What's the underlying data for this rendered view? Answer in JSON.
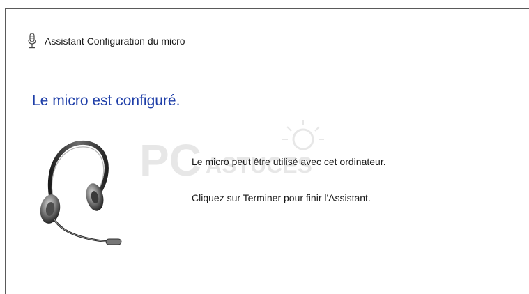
{
  "window": {
    "title": "Assistant Configuration du micro",
    "icon": "microphone-icon"
  },
  "content": {
    "heading": "Le micro est configuré.",
    "message_line1": "Le micro peut être utilisé avec cet ordinateur.",
    "message_line2": "Cliquez sur Terminer pour finir l'Assistant.",
    "illustration": "headset-icon"
  },
  "watermark": {
    "text_pc": "PC",
    "text_astuces": "ASTUCES"
  },
  "colors": {
    "heading": "#1e3ea8",
    "text": "#1a1a1a",
    "border": "#5a5a5a"
  }
}
